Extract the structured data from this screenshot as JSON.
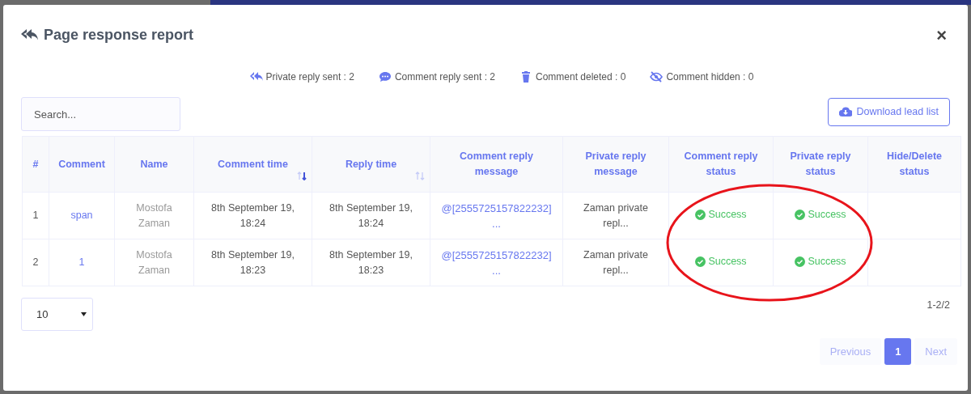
{
  "modal": {
    "title": "Page response report",
    "close": "×"
  },
  "stats": [
    {
      "kind": "reply-all",
      "label": "Private reply sent : 2"
    },
    {
      "kind": "comment",
      "label": "Comment reply sent : 2"
    },
    {
      "kind": "trash",
      "label": "Comment deleted : 0"
    },
    {
      "kind": "hidden",
      "label": "Comment hidden : 0"
    }
  ],
  "search": {
    "placeholder": "Search..."
  },
  "download_button": "Download lead list",
  "table": {
    "columns": [
      {
        "label": "#",
        "sortable": false
      },
      {
        "label": "Comment",
        "sortable": false
      },
      {
        "label": "Name",
        "sortable": false
      },
      {
        "label": "Comment time",
        "sortable": true,
        "sorted_desc": true
      },
      {
        "label": "Reply time",
        "sortable": true,
        "sorted_desc": false
      },
      {
        "label": "Comment reply message",
        "sortable": false
      },
      {
        "label": "Private reply message",
        "sortable": false
      },
      {
        "label": "Comment reply status",
        "sortable": false
      },
      {
        "label": "Private reply status",
        "sortable": false
      },
      {
        "label": "Hide/Delete status",
        "sortable": false
      }
    ],
    "rows": [
      {
        "index": "1",
        "comment": "span",
        "name": "Mostofa Zaman",
        "comment_time": "8th September 19, 18:24",
        "reply_time": "8th September 19, 18:24",
        "comment_reply_message": "@[2555725157822232] ...",
        "private_reply_message": "Zaman private repl...",
        "comment_reply_status": {
          "kind": "success",
          "text": "Success"
        },
        "private_reply_status": {
          "kind": "success",
          "text": "Success"
        }
      },
      {
        "index": "2",
        "comment": "1",
        "name": "Mostofa Zaman",
        "comment_time": "8th September 19, 18:23",
        "reply_time": "8th September 19, 18:23",
        "comment_reply_message": "@[2555725157822232] ...",
        "private_reply_message": "Zaman private repl...",
        "comment_reply_status": {
          "kind": "success",
          "text": "Success"
        },
        "private_reply_status": {
          "kind": "success",
          "text": "Success"
        }
      }
    ]
  },
  "page_size": "10",
  "range": "1-2/2",
  "pagination": [
    {
      "label": "Previous",
      "kind": "nav",
      "disabled": true,
      "selected": false
    },
    {
      "label": "1",
      "kind": "page",
      "selected": true
    },
    {
      "label": "Next",
      "kind": "nav",
      "disabled": true,
      "selected": false
    }
  ]
}
